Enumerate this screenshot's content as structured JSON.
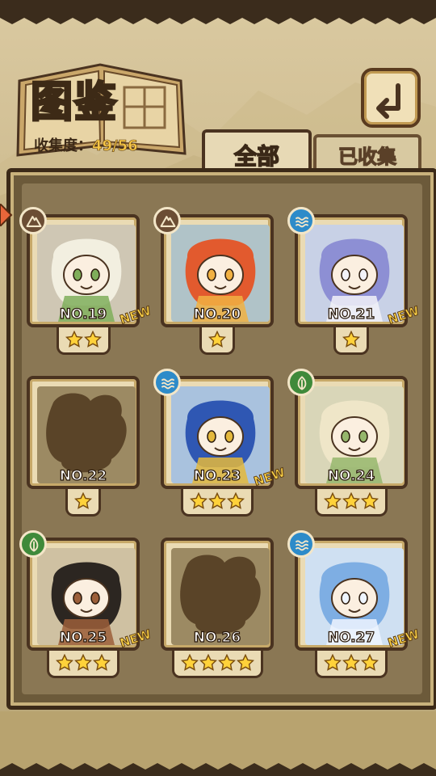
{
  "header": {
    "title": "图鉴",
    "collection_label": "收集度：",
    "collection_value": "49/56"
  },
  "tabs": [
    {
      "label": "全部",
      "active": true
    },
    {
      "label": "已收集",
      "active": false
    }
  ],
  "colors": {
    "mountain": "#6b4d34",
    "water": "#2d8bc9",
    "grass": "#3f8a3a",
    "silhouette": "#5a4428"
  },
  "cards": [
    {
      "no": "NO.19",
      "element": "mountain",
      "stars": 2,
      "new": true,
      "new_label": "NEW",
      "art": "flower-girl"
    },
    {
      "no": "NO.20",
      "element": "mountain",
      "stars": 1,
      "new": false,
      "art": "fox-girl"
    },
    {
      "no": "NO.21",
      "element": "water",
      "stars": 1,
      "new": true,
      "new_label": "NEW",
      "art": "blue-fox-girl"
    },
    {
      "no": "NO.22",
      "element": "",
      "stars": 1,
      "new": false,
      "art": "silhouette"
    },
    {
      "no": "NO.23",
      "element": "water",
      "stars": 3,
      "new": true,
      "new_label": "NEW",
      "art": "bell-cat-girl"
    },
    {
      "no": "NO.24",
      "element": "grass",
      "stars": 3,
      "new": false,
      "art": "fairy-girl"
    },
    {
      "no": "NO.25",
      "element": "grass",
      "stars": 3,
      "new": true,
      "new_label": "NEW",
      "art": "warrior-girl"
    },
    {
      "no": "NO.26",
      "element": "",
      "stars": 4,
      "new": false,
      "art": "silhouette"
    },
    {
      "no": "NO.27",
      "element": "water",
      "stars": 3,
      "new": true,
      "new_label": "NEW",
      "art": "mermaid-girl"
    }
  ]
}
